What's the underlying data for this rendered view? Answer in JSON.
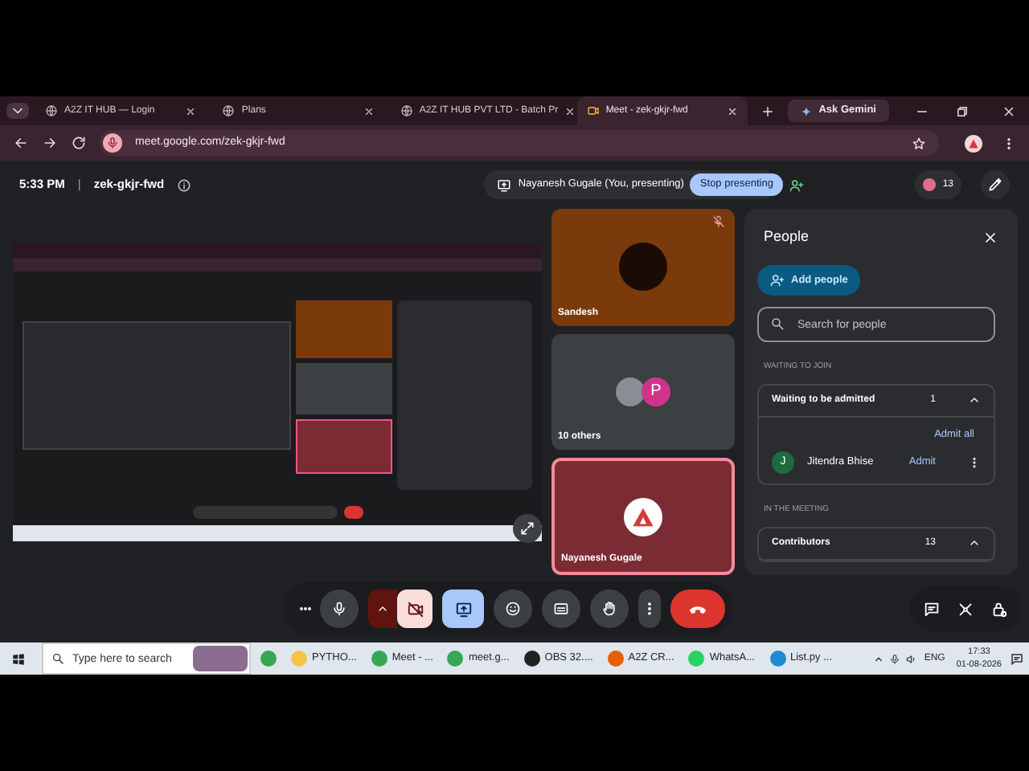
{
  "browser": {
    "tabs": [
      {
        "title": "A2Z IT HUB — Login",
        "selected": false
      },
      {
        "title": "Plans",
        "selected": false
      },
      {
        "title": "A2Z IT HUB PVT LTD - Batch Pr",
        "selected": false
      },
      {
        "title": "Meet - zek-gkjr-fwd",
        "selected": true
      }
    ],
    "gemini": "Ask Gemini",
    "url": "meet.google.com/zek-gkjr-fwd"
  },
  "meet": {
    "time": "5:33 PM",
    "separator": "|",
    "code": "zek-gkjr-fwd",
    "presenting": "Nayanesh Gugale (You, presenting)",
    "stop_button": "Stop presenting",
    "people_count": "13",
    "tiles": [
      {
        "kind": "photo",
        "name": "Sandesh",
        "color": "#7a3a0c",
        "muted": true,
        "highlighted": false
      },
      {
        "kind": "group",
        "name": "10 others",
        "color": "#3c4043",
        "initial": "P",
        "muted": false,
        "highlighted": false
      },
      {
        "kind": "logo",
        "name": "Nayanesh Gugale",
        "color": "#7b2b33",
        "muted": false,
        "highlighted": true
      }
    ],
    "controls": [
      {
        "kind": "more"
      },
      {
        "kind": "mic",
        "on": true
      },
      {
        "kind": "caret"
      },
      {
        "kind": "camera",
        "on": false
      },
      {
        "kind": "present",
        "on": true
      },
      {
        "kind": "emoji"
      },
      {
        "kind": "captions"
      },
      {
        "kind": "hand"
      },
      {
        "kind": "kebab"
      },
      {
        "kind": "hangup"
      }
    ],
    "side_controls": [
      {
        "kind": "chat"
      },
      {
        "kind": "activities"
      },
      {
        "kind": "lock"
      }
    ]
  },
  "people_panel": {
    "title": "People",
    "add_button": "Add people",
    "search": {
      "placeholder": "Search for people"
    },
    "sections": [
      {
        "heading": "WAITING TO JOIN",
        "group": "Waiting to be admitted",
        "count": "1",
        "expanded": true,
        "action": "Admit all",
        "people": [
          {
            "initial": "J",
            "name": "Jitendra Bhise",
            "color": "#1e6b3f",
            "action": "Admit"
          }
        ]
      },
      {
        "heading": "IN THE MEETING",
        "group": "Contributors",
        "count": "13",
        "expanded": true
      }
    ]
  },
  "taskbar": {
    "search": {
      "placeholder": "Type here to search"
    },
    "apps": [
      {
        "kind": "chrome"
      },
      {
        "kind": "folder",
        "label": "PYTHO..."
      },
      {
        "kind": "chrome",
        "label": "Meet - ..."
      },
      {
        "kind": "chrome",
        "label": "meet.g..."
      },
      {
        "kind": "obs",
        "label": "OBS 32...."
      },
      {
        "kind": "firefox",
        "label": "A2Z CR..."
      },
      {
        "kind": "whatsapp",
        "label": "WhatsA..."
      },
      {
        "kind": "vscode",
        "label": "List.py ..."
      }
    ],
    "language": "ENG",
    "time": "17:33",
    "date": "01-08-2026"
  }
}
